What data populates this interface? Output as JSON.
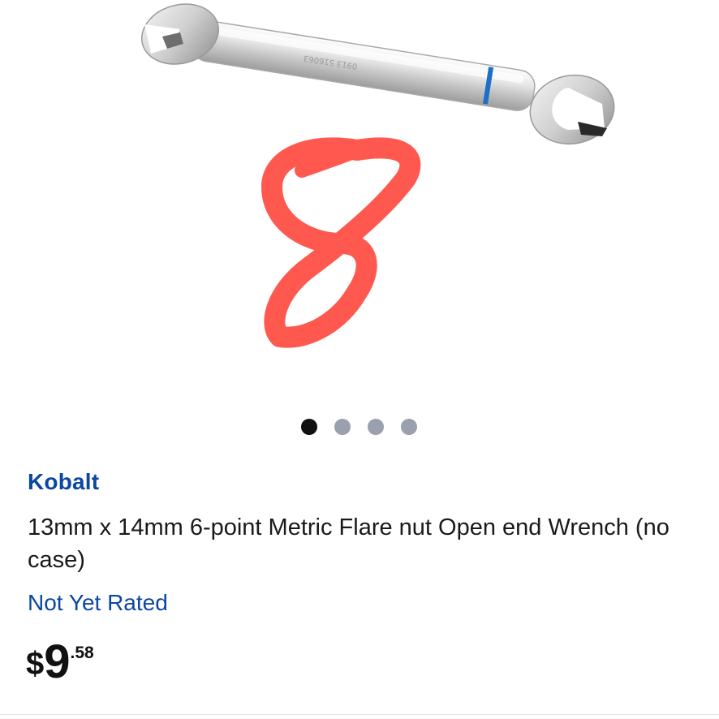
{
  "gallery": {
    "image_alt": "Kobalt flare nut wrench",
    "annotation_glyph": "8",
    "slide_count": 4,
    "active_slide": 1
  },
  "product": {
    "brand": "Kobalt",
    "title": "13mm x 14mm 6-point Metric Flare nut Open end Wrench (no case)",
    "rating_text": "Not Yet Rated",
    "price": {
      "currency": "$",
      "whole": "9",
      "cents": ".58"
    }
  },
  "colors": {
    "brand": "#0b47a1",
    "dot_active": "#111111",
    "dot_inactive": "#9aa0ad",
    "annotation": "#ff3b30"
  }
}
